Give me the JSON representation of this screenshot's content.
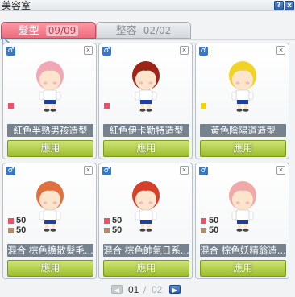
{
  "window": {
    "title": "美容室",
    "help_label": "?",
    "close_label": "x"
  },
  "tabs": [
    {
      "label": "髮型",
      "count": "09/09"
    },
    {
      "label": "整容",
      "count": "02/02"
    }
  ],
  "cards": [
    {
      "gender": "♂",
      "name": "紅色半熟男孩造型",
      "apply_label": "應用",
      "hair_color": "#f2a7b5",
      "swatches": [
        {
          "color": "#e8536b"
        }
      ]
    },
    {
      "gender": "♂",
      "name": "紅色伊卡勒特造型",
      "apply_label": "應用",
      "hair_color": "#9e2418",
      "swatches": [
        {
          "color": "#e8536b"
        }
      ]
    },
    {
      "gender": "♂",
      "name": "黃色陰陽道造型",
      "apply_label": "應用",
      "hair_color": "#f1d227",
      "swatches": [
        {
          "color": "#f3d400"
        }
      ]
    },
    {
      "gender": "♂",
      "name": "混合 棕色擴散髮毛...",
      "apply_label": "應用",
      "hair_color": "#e0703d",
      "swatches": [
        {
          "color": "#e8536b",
          "pct": "50"
        },
        {
          "color": "#b58a6a",
          "pct": "50"
        }
      ]
    },
    {
      "gender": "♂",
      "name": "混合 棕色帥氣日系...",
      "apply_label": "應用",
      "hair_color": "#d5402b",
      "swatches": [
        {
          "color": "#e8536b",
          "pct": "50"
        },
        {
          "color": "#b58a6a",
          "pct": "50"
        }
      ]
    },
    {
      "gender": "♂",
      "name": "混合 棕色妖精翁造...",
      "apply_label": "應用",
      "hair_color": "#f0a8a8",
      "swatches": [
        {
          "color": "#e8536b",
          "pct": "50"
        },
        {
          "color": "#b58a6a",
          "pct": "50"
        }
      ]
    }
  ],
  "pager": {
    "current": "01",
    "separator": "/",
    "total": "02"
  }
}
